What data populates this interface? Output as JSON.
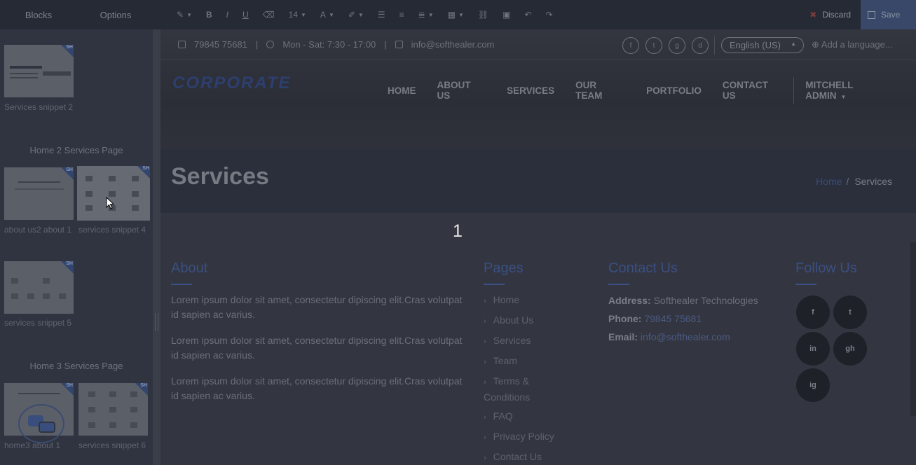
{
  "toolbar": {
    "tabs": [
      "Blocks",
      "Options"
    ],
    "font_size": "14",
    "discard_label": "Discard",
    "save_label": "Save"
  },
  "sidebar": {
    "thumbs": [
      {
        "label": "Services snippet 2"
      },
      {
        "label": "about us2 about 1"
      },
      {
        "label": "services snippet 4"
      },
      {
        "label": "services snippet 5"
      },
      {
        "label": "home3 about 1"
      },
      {
        "label": "services snippet 6"
      }
    ],
    "section_home2": "Home 2 Services Page",
    "section_home3": "Home 3 Services Page",
    "tag_text": "SH"
  },
  "site": {
    "phone": "79845 75681",
    "hours": "Mon - Sat: 7:30 - 17:00",
    "email": "info@softhealer.com",
    "language": "English (US)",
    "add_language": "Add a language...",
    "logo": "CORPORATE",
    "nav": [
      "HOME",
      "ABOUT US",
      "SERVICES",
      "OUR TEAM",
      "PORTFOLIO",
      "CONTACT US"
    ],
    "user": "MITCHELL ADMIN",
    "page_title": "Services",
    "breadcrumb_home": "Home",
    "breadcrumb_current": "Services",
    "marker": "1",
    "socials": [
      "f",
      "t",
      "g",
      "d"
    ]
  },
  "footer": {
    "about_title": "About",
    "about_paragraphs": [
      "Lorem ipsum dolor sit amet, consectetur dipiscing elit.Cras volutpat id sapien ac varius.",
      "Lorem ipsum dolor sit amet, consectetur dipiscing elit.Cras volutpat id sapien ac varius.",
      "Lorem ipsum dolor sit amet, consectetur dipiscing elit.Cras volutpat id sapien ac varius."
    ],
    "pages_title": "Pages",
    "pages": [
      "Home",
      "About Us",
      "Services",
      "Team",
      "Terms & Conditions",
      "FAQ",
      "Privacy Policy",
      "Contact Us"
    ],
    "contact_title": "Contact Us",
    "address_label": "Address:",
    "address_value": "Softhealer Technologies",
    "phone_label": "Phone:",
    "phone_value": "79845 75681",
    "email_label": "Email:",
    "email_value": "info@softhealer.com",
    "follow_title": "Follow Us",
    "follow_icons": [
      "f",
      "t",
      "in",
      "gh",
      "ig"
    ]
  },
  "colors": {
    "accent": "#3a4f83",
    "toolbar_bg": "#262a35",
    "sidebar_bg": "#2f3440",
    "save_bg": "#394868"
  }
}
